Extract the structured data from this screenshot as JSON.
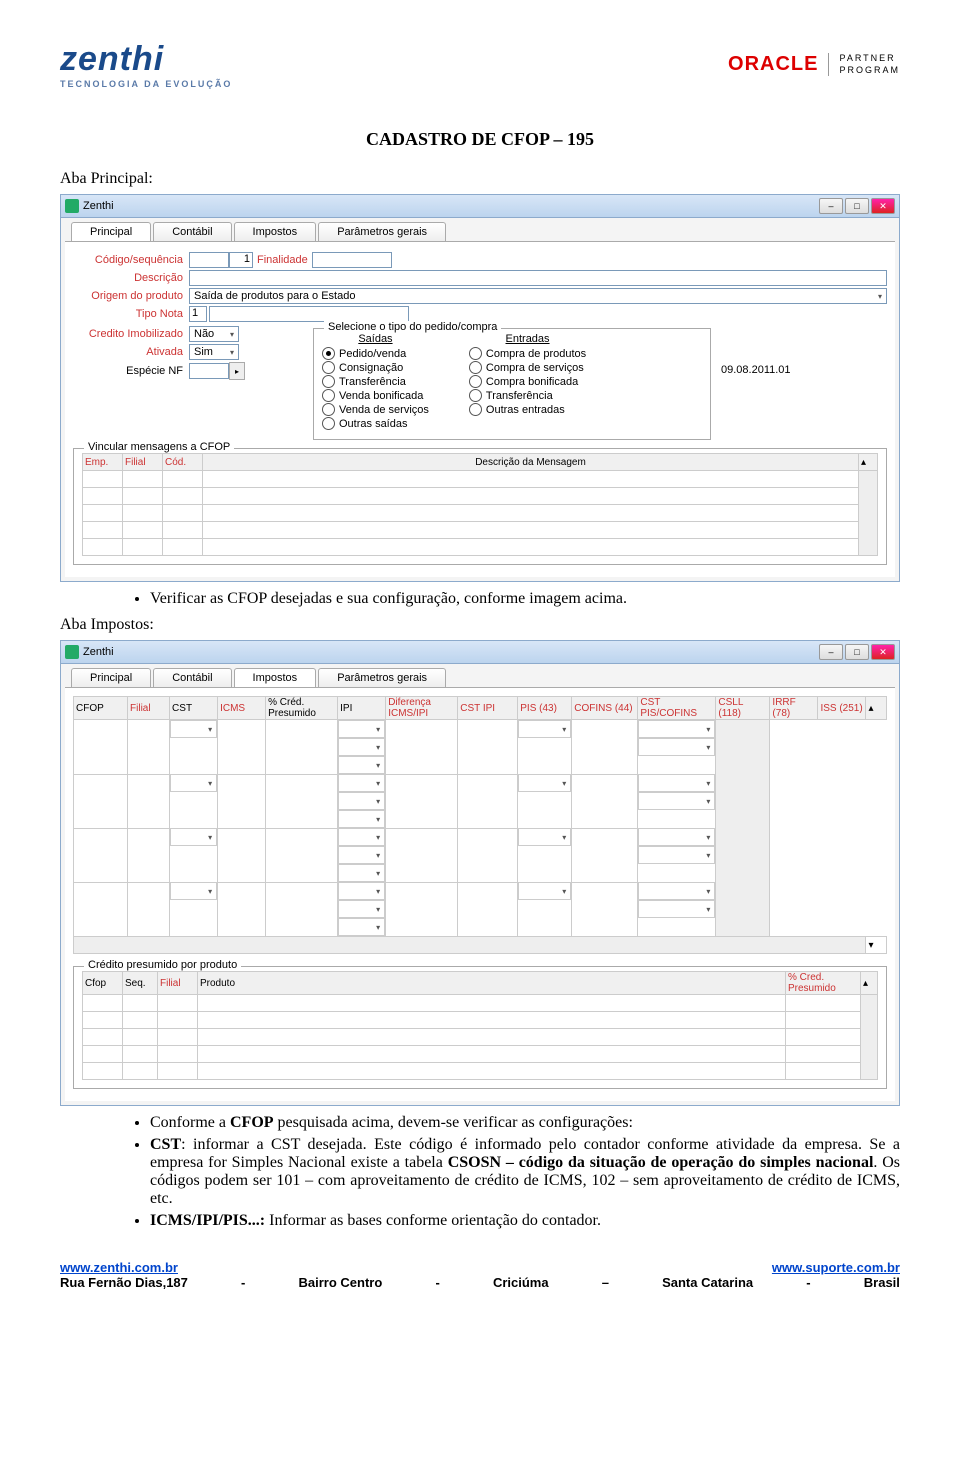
{
  "header": {
    "zenthi_brand": "zenthi",
    "zenthi_tag": "TECNOLOGIA DA EVOLUÇÃO",
    "oracle_brand": "ORACLE",
    "oracle_partner1": "PARTNER",
    "oracle_partner2": "PROGRAM"
  },
  "title": "CADASTRO DE CFOP – 195",
  "section_principal_label": "Aba Principal:",
  "section_impostos_label": "Aba Impostos:",
  "window": {
    "title": "Zenthi",
    "tabs": [
      "Principal",
      "Contábil",
      "Impostos",
      "Parâmetros gerais"
    ]
  },
  "principal_form": {
    "codigo_seq_label": "Código/sequência",
    "codigo_value": "",
    "seq_value": "1",
    "finalidade_label": "Finalidade",
    "finalidade_value": "",
    "descricao_label": "Descrição",
    "descricao_value": "",
    "origem_label": "Origem do produto",
    "origem_value": "Saída de produtos para o Estado",
    "tipo_nota_label": "Tipo Nota",
    "tipo_nota_value": "1",
    "credito_imob_label": "Credito Imobilizado",
    "credito_imob_value": "Não",
    "ativada_label": "Ativada",
    "ativada_value": "Sim",
    "especie_label": "Espécie NF",
    "especie_value": "",
    "tipo_pedido_legend": "Selecione o tipo do pedido/compra",
    "saidas_heading": "Saídas",
    "entradas_heading": "Entradas",
    "saidas": [
      "Pedido/venda",
      "Consignação",
      "Transferência",
      "Venda bonificada",
      "Venda de serviços",
      "Outras saídas"
    ],
    "entradas": [
      "Compra de produtos",
      "Compra de serviços",
      "Compra bonificada",
      "Transferência",
      "Outras entradas"
    ],
    "date_label": "09.08.2011.01",
    "vincula_legend": "Vincular mensagens a CFOP",
    "vincula_cols": [
      "Emp.",
      "Filial",
      "Cód."
    ],
    "vincula_msg_col": "Descrição da Mensagem"
  },
  "principal_bullet": "Verificar as CFOP desejadas e sua configuração, conforme imagem acima.",
  "impostos_table": {
    "cols": [
      "CFOP",
      "Filial",
      "CST",
      "ICMS",
      "% Créd. Presumido",
      "IPI",
      "Diferença ICMS/IPI",
      "CST IPI",
      "PIS (43)",
      "COFINS (44)",
      "CST PIS/COFINS",
      "CSLL (118)",
      "IRRF (78)",
      "ISS (251)"
    ],
    "red_cols": [
      "Filial",
      "ICMS",
      "Diferença ICMS/IPI",
      "CST IPI",
      "PIS (43)",
      "COFINS (44)",
      "CST PIS/COFINS",
      "CSLL (118)",
      "IRRF (78)",
      "ISS (251)"
    ]
  },
  "credito_presumido": {
    "legend": "Crédito presumido por produto",
    "cols": [
      "Cfop",
      "Seq.",
      "Filial",
      "Produto"
    ],
    "right_col": "% Cred. Presumido"
  },
  "impostos_bullets": {
    "b1_pre": "Conforme a ",
    "b1_bold": "CFOP",
    "b1_post": " pesquisada acima, devem-se verificar as configurações:",
    "b2_bold": "CST",
    "b2_text": ": informar a CST desejada. Este código é informado pelo contador conforme atividade da empresa. Se a empresa for Simples Nacional existe a tabela ",
    "b2_bold2": "CSOSN – código da situação de operação do simples nacional",
    "b2_text2": ". Os códigos podem ser 101 – com aproveitamento de crédito de ICMS, 102 – sem aproveitamento de crédito de ICMS, etc.",
    "b3_bold": "ICMS/IPI/PIS...:",
    "b3_text": " Informar as bases conforme orientação do contador."
  },
  "footer": {
    "url_left": "www.zenthi.com.br",
    "url_right": "www.suporte.com.br",
    "addr": [
      "Rua Fernão Dias,187",
      "-",
      "Bairro Centro",
      "-",
      "Criciúma",
      "–",
      "Santa Catarina",
      "-",
      "Brasil"
    ]
  }
}
